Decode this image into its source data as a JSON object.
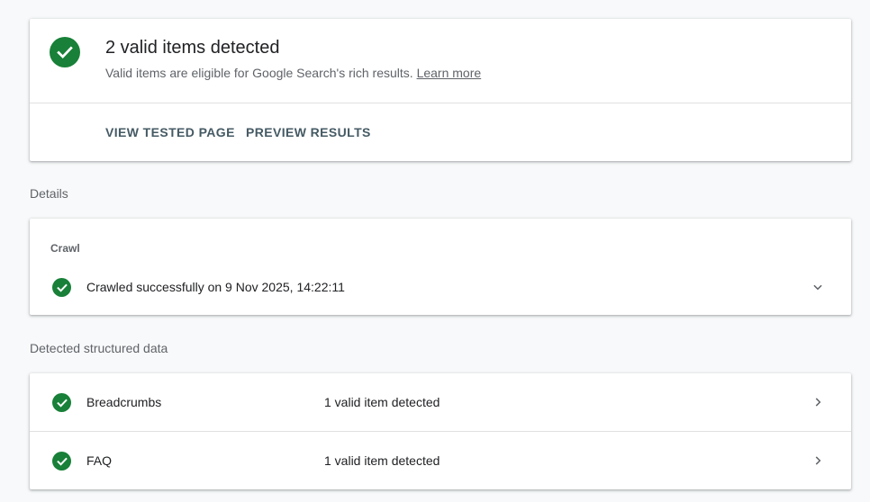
{
  "summary": {
    "title": "2 valid items detected",
    "subtitle": "Valid items are eligible for Google Search's rich results.",
    "learn_more": "Learn more",
    "buttons": {
      "view_tested_page": "VIEW TESTED PAGE",
      "preview_results": "PREVIEW RESULTS"
    }
  },
  "sections": {
    "details": "Details",
    "detected": "Detected structured data"
  },
  "crawl": {
    "heading": "Crawl",
    "status": "Crawled successfully on 9 Nov 2025, 14:22:11"
  },
  "structured_data": [
    {
      "name": "Breadcrumbs",
      "status": "1 valid item detected"
    },
    {
      "name": "FAQ",
      "status": "1 valid item detected"
    }
  ],
  "icons": {
    "status": "check-circle-icon",
    "expand": "chevron-down-icon",
    "open": "chevron-right-icon"
  },
  "colors": {
    "success": "#188038",
    "action": "#455a64",
    "muted": "#5f6368"
  }
}
